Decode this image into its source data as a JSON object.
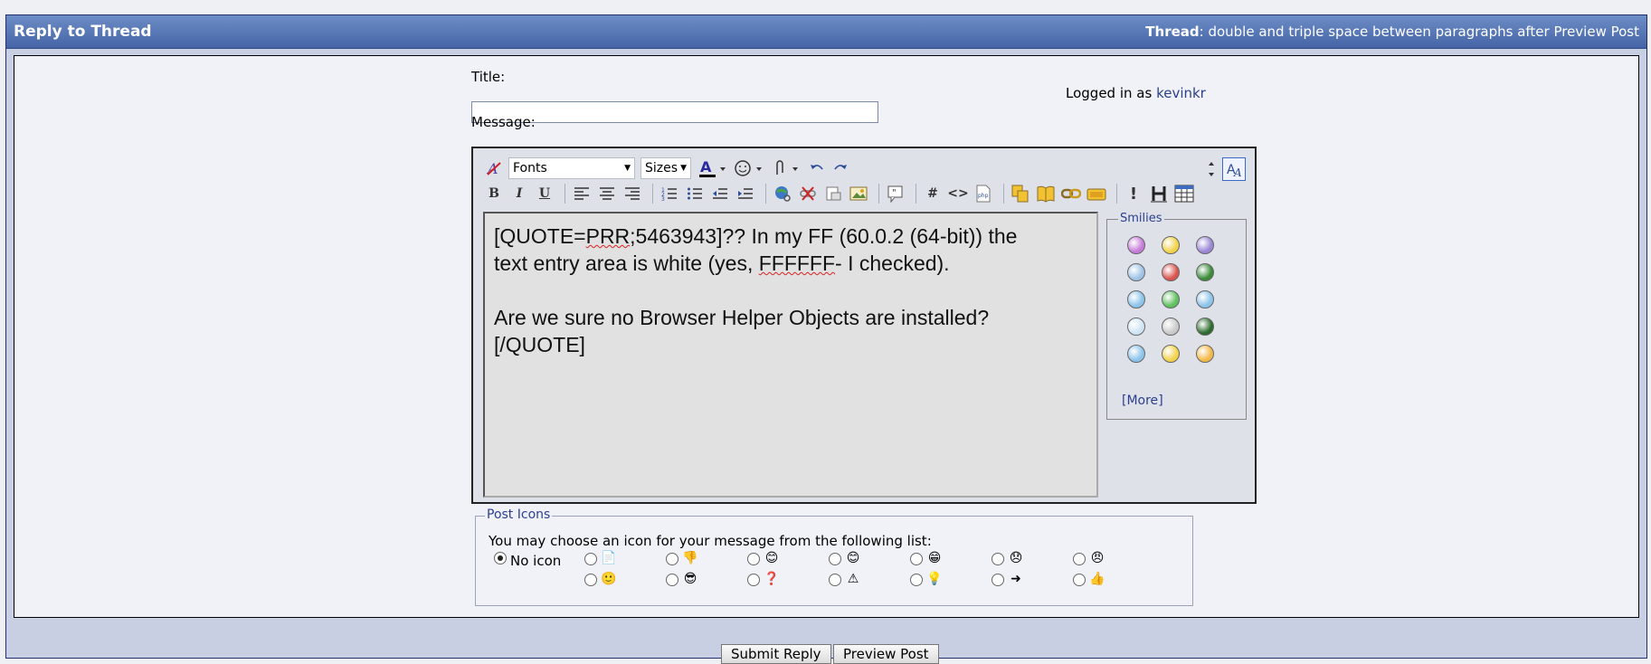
{
  "header": {
    "title": "Reply to Thread",
    "thread_label": "Thread",
    "thread_title": ": double and triple space between paragraphs after Preview Post"
  },
  "form": {
    "title_label": "Title:",
    "title_value": "",
    "message_label": "Message:",
    "logged_in_prefix": "Logged in as",
    "username": "kevinkr"
  },
  "toolbar": {
    "fonts": "Fonts",
    "sizes": "Sizes"
  },
  "message_text": {
    "line1_a": "[QUOTE=",
    "line1_spell": "PRR",
    "line1_b": ";5463943]?? In my FF (60.0.2 (64-bit)) the",
    "line2_a": "text entry area is white (yes, ",
    "line2_spell": "FFFFFF",
    "line2_b": "- I checked).",
    "line3": "Are we sure no Browser Helper Objects are installed?",
    "line4": "[/QUOTE]"
  },
  "smilies": {
    "legend": "Smilies",
    "more_label": "More",
    "colors": [
      "#c57bd8",
      "#f2d24a",
      "#9a87d6",
      "#9fc3e6",
      "#d9534f",
      "#3a8a3a",
      "#8bc3ea",
      "#5fbf5f",
      "#8bc3ea",
      "#cfe4f5",
      "#c9c9c9",
      "#2c6b2c",
      "#8bc3ea",
      "#f2d24a",
      "#f2b94a"
    ]
  },
  "post_icons": {
    "legend": "Post Icons",
    "description": "You may choose an icon for your message from the following list:",
    "no_icon_label": "No icon",
    "icons": [
      "📄",
      "👎",
      "😊",
      "😊",
      "😁",
      "😞",
      "😠",
      "🙂",
      "😎",
      "❓",
      "⚠",
      "💡",
      "➜",
      "👍"
    ]
  },
  "buttons": {
    "submit": "Submit Reply",
    "preview": "Preview Post"
  }
}
